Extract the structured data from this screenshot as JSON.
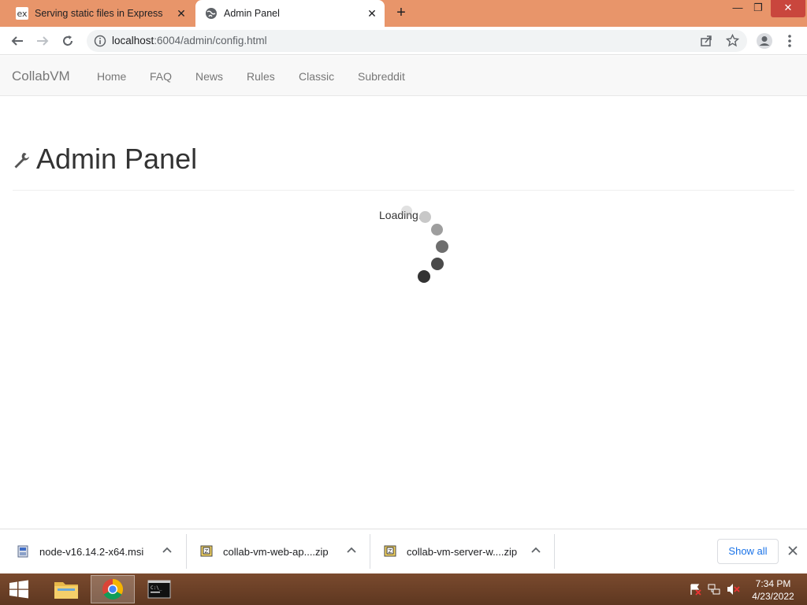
{
  "browser": {
    "tabs": [
      {
        "title": "Serving static files in Express",
        "favicon": "ex"
      },
      {
        "title": "Admin Panel",
        "favicon": "globe-icon"
      }
    ],
    "url_host": "localhost",
    "url_rest": ":6004/admin/config.html"
  },
  "navbar": {
    "brand": "CollabVM",
    "links": [
      "Home",
      "FAQ",
      "News",
      "Rules",
      "Classic",
      "Subreddit"
    ]
  },
  "content": {
    "title": "Admin Panel",
    "loading_text": "Loading..."
  },
  "downloads": {
    "items": [
      {
        "name": "node-v16.14.2-x64.msi",
        "icon": "installer-icon"
      },
      {
        "name": "collab-vm-web-ap....zip",
        "icon": "zip-icon"
      },
      {
        "name": "collab-vm-server-w....zip",
        "icon": "zip-icon"
      }
    ],
    "show_all": "Show all"
  },
  "taskbar": {
    "time": "7:34 PM",
    "date": "4/23/2022"
  },
  "colors": {
    "tabstrip": "#e8956a",
    "taskbar": "#6b3f25",
    "link_blue": "#1a73e8"
  }
}
